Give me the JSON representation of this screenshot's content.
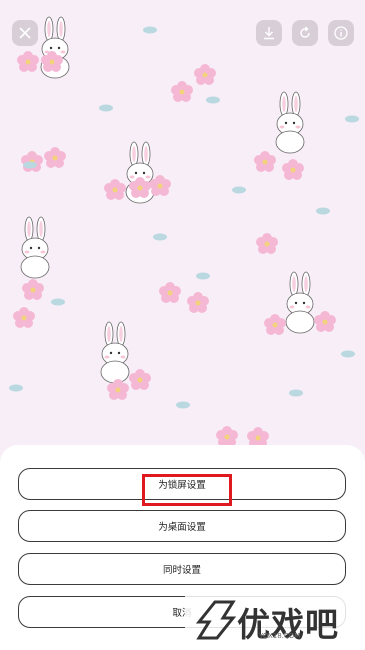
{
  "options": {
    "lock_screen": "为锁屏设置",
    "desktop": "为桌面设置",
    "both": "同时设置",
    "cancel": "取消"
  },
  "watermark": {
    "brand": "优戏吧",
    "domain": "YOX18.COM"
  },
  "colors": {
    "wallpaper_bg": "#f8eef8",
    "flower": "#f5b8d4",
    "leaf": "#b9d8e0",
    "highlight": "#e0191f"
  },
  "icons": [
    "close-icon",
    "download-icon",
    "rotate-icon",
    "info-icon"
  ]
}
